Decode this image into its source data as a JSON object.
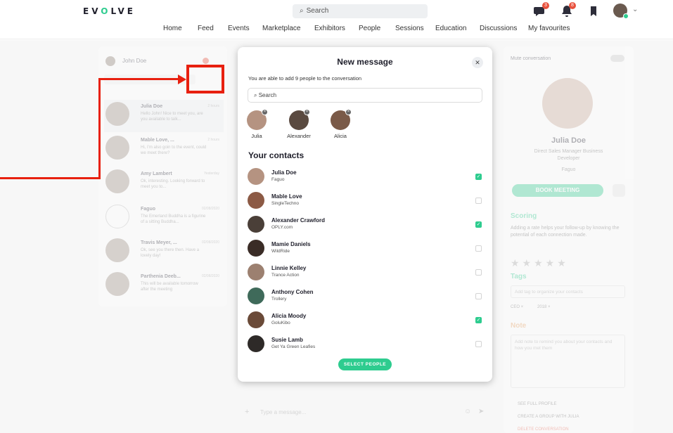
{
  "header": {
    "logo": "EVOLVE",
    "search_placeholder": "Search",
    "messages_badge": "3",
    "notifications_badge": "8"
  },
  "nav": [
    "Home",
    "Feed",
    "Events",
    "Marketplace",
    "Exhibitors",
    "People",
    "Sessions",
    "Education",
    "Discussions",
    "My favourites"
  ],
  "left_panel": {
    "user": "John Doe",
    "conversations": [
      {
        "name": "Julia Doe",
        "message": "Hello John! Nice to meet you, are you available to talk...",
        "time": "2 hours"
      },
      {
        "name": "Mable Love, ...",
        "message": "Hi, I'm also goin to the event, could we meet there?",
        "time": "2 hours"
      },
      {
        "name": "Amy Lambert",
        "message": "Ok, interesting. Looking forward to meet you to...",
        "time": "Yesterday"
      },
      {
        "name": "Faguo",
        "message": "The Emerland Buddha is a figurine of a sitting Buddha...",
        "time": "02/08/2020"
      },
      {
        "name": "Travis Meyer, ...",
        "message": "Ok, see you there then. Have a lovely day!",
        "time": "02/08/2020"
      },
      {
        "name": "Parthenia Deeb...",
        "message": "This will be available tomorrow after the meeting",
        "time": "02/08/2020"
      }
    ]
  },
  "modal": {
    "title": "New message",
    "subtext": "You are able to add 9 people to the conversation",
    "search_placeholder": "Search",
    "selected": [
      "Julia",
      "Alexander",
      "Alicia"
    ],
    "contacts_heading": "Your contacts",
    "contacts": [
      {
        "name": "Julia Doe",
        "company": "Faguo",
        "checked": true
      },
      {
        "name": "Mable Love",
        "company": "SingleTechno",
        "checked": false
      },
      {
        "name": "Alexander Crawford",
        "company": "OPLY.com",
        "checked": true
      },
      {
        "name": "Mamie Daniels",
        "company": "WildRide",
        "checked": false
      },
      {
        "name": "Linnie Kelley",
        "company": "Trance Action",
        "checked": false
      },
      {
        "name": "Anthony Cohen",
        "company": "Trollery",
        "checked": false
      },
      {
        "name": "Alicia Moody",
        "company": "GoluKibo",
        "checked": true
      },
      {
        "name": "Susie Lamb",
        "company": "Get Ya Green Leafies",
        "checked": false
      }
    ],
    "select_button": "SELECT PEOPLE"
  },
  "right_panel": {
    "mute": "Mute conversation",
    "name": "Julia Doe",
    "role": "Direct Sales Manager Business Developer",
    "company": "Faguo",
    "book_button": "BOOK MEETING",
    "scoring_title": "Scoring",
    "scoring_text": "Adding a rate helps your follow-up by knowing the potential of each connection made.",
    "tags_title": "Tags",
    "tags_placeholder": "Add tag to organize your contacts",
    "tags": [
      "CEO ×",
      "2018 ×"
    ],
    "note_title": "Note",
    "note_placeholder": "Add note to remind you about your contacts and how you met them",
    "actions": [
      "SEE FULL PROFILE",
      "CREATE A GROUP WITH JULIA",
      "DELETE CONVERSATION"
    ]
  },
  "chat": {
    "placeholder": "Type a message..."
  }
}
